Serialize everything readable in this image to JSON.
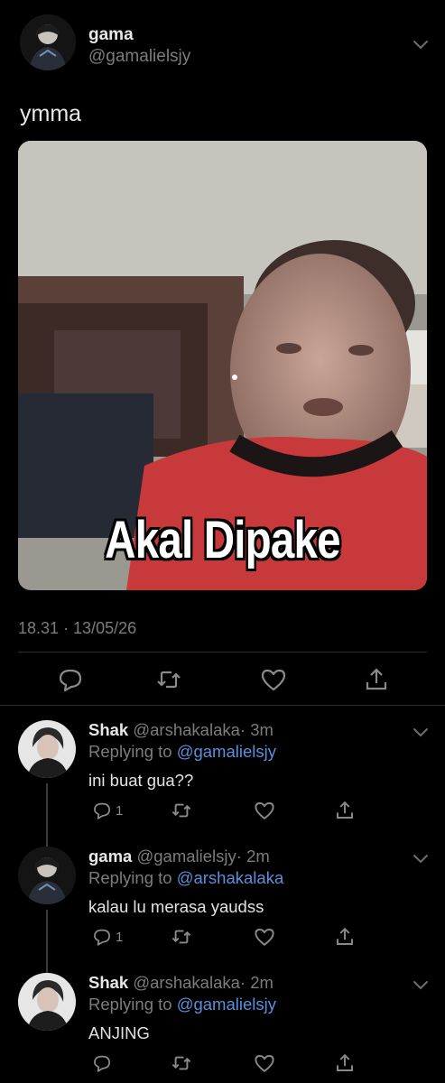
{
  "tweet": {
    "author_name": "gama",
    "author_handle": "@gamalielsjy",
    "text": "ymma",
    "media_caption": "Akal Dipake",
    "timestamp": "18.31 · 13/05/26"
  },
  "replies": [
    {
      "name": "Shak",
      "handle": "@arshakalaka",
      "time": "· 3m",
      "replying_prefix": "Replying to ",
      "replying_to": "@gamalielsjy",
      "text": "ini buat gua??",
      "reply_count": "1"
    },
    {
      "name": "gama",
      "handle": "@gamalielsjy",
      "time": "· 2m",
      "replying_prefix": "Replying to ",
      "replying_to": "@arshakalaka",
      "text": "kalau lu merasa yaudss",
      "reply_count": "1"
    },
    {
      "name": "Shak",
      "handle": "@arshakalaka",
      "time": "· 2m",
      "replying_prefix": "Replying to ",
      "replying_to": "@gamalielsjy",
      "text": "ANJING",
      "reply_count": ""
    }
  ],
  "colors": {
    "background": "#000000",
    "link": "#5b8fdb",
    "secondary_text": "#7c7c7c",
    "primary_text": "#e7e7e7",
    "icon": "#8a8a8a"
  },
  "icons": {
    "more": "chevron-down-icon",
    "reply": "reply-bubble-icon",
    "retweet": "retweet-icon",
    "like": "heart-icon",
    "share": "share-icon"
  }
}
